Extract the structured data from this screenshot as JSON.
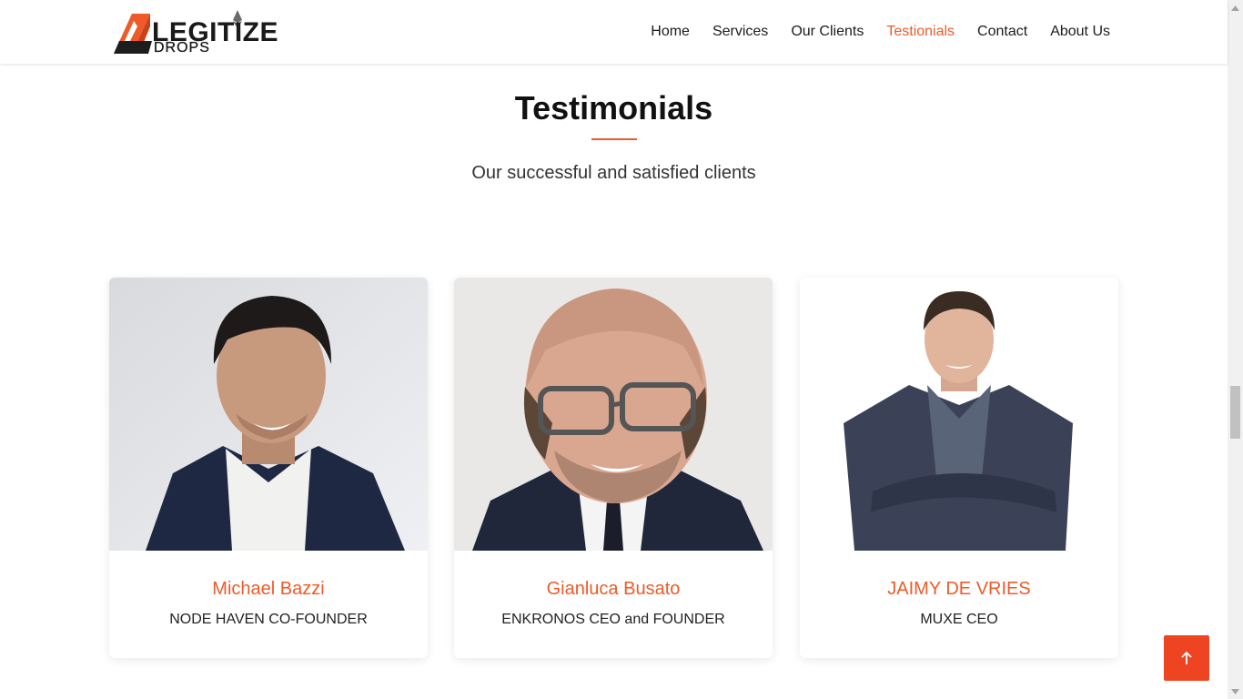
{
  "brand": {
    "name": "LEGITIZE",
    "tagline": "DROPS"
  },
  "nav": {
    "items": [
      {
        "label": "Home",
        "active": false
      },
      {
        "label": "Services",
        "active": false
      },
      {
        "label": "Our Clients",
        "active": false
      },
      {
        "label": "Testionials",
        "active": true
      },
      {
        "label": "Contact",
        "active": false
      },
      {
        "label": "About Us",
        "active": false
      }
    ]
  },
  "section": {
    "title": "Testimonials",
    "subtitle": "Our successful and satisfied clients"
  },
  "testimonials": [
    {
      "name": "Michael Bazzi",
      "role": "NODE HAVEN CO-FOUNDER"
    },
    {
      "name": "Gianluca Busato",
      "role": "ENKRONOS CEO and FOUNDER"
    },
    {
      "name": "JAIMY DE VRIES",
      "role": "MUXE CEO"
    }
  ],
  "back_to_top": {
    "icon": "arrow-up-icon"
  },
  "colors": {
    "accent": "#ef5a28",
    "back_to_top_bg": "#ef4422"
  }
}
